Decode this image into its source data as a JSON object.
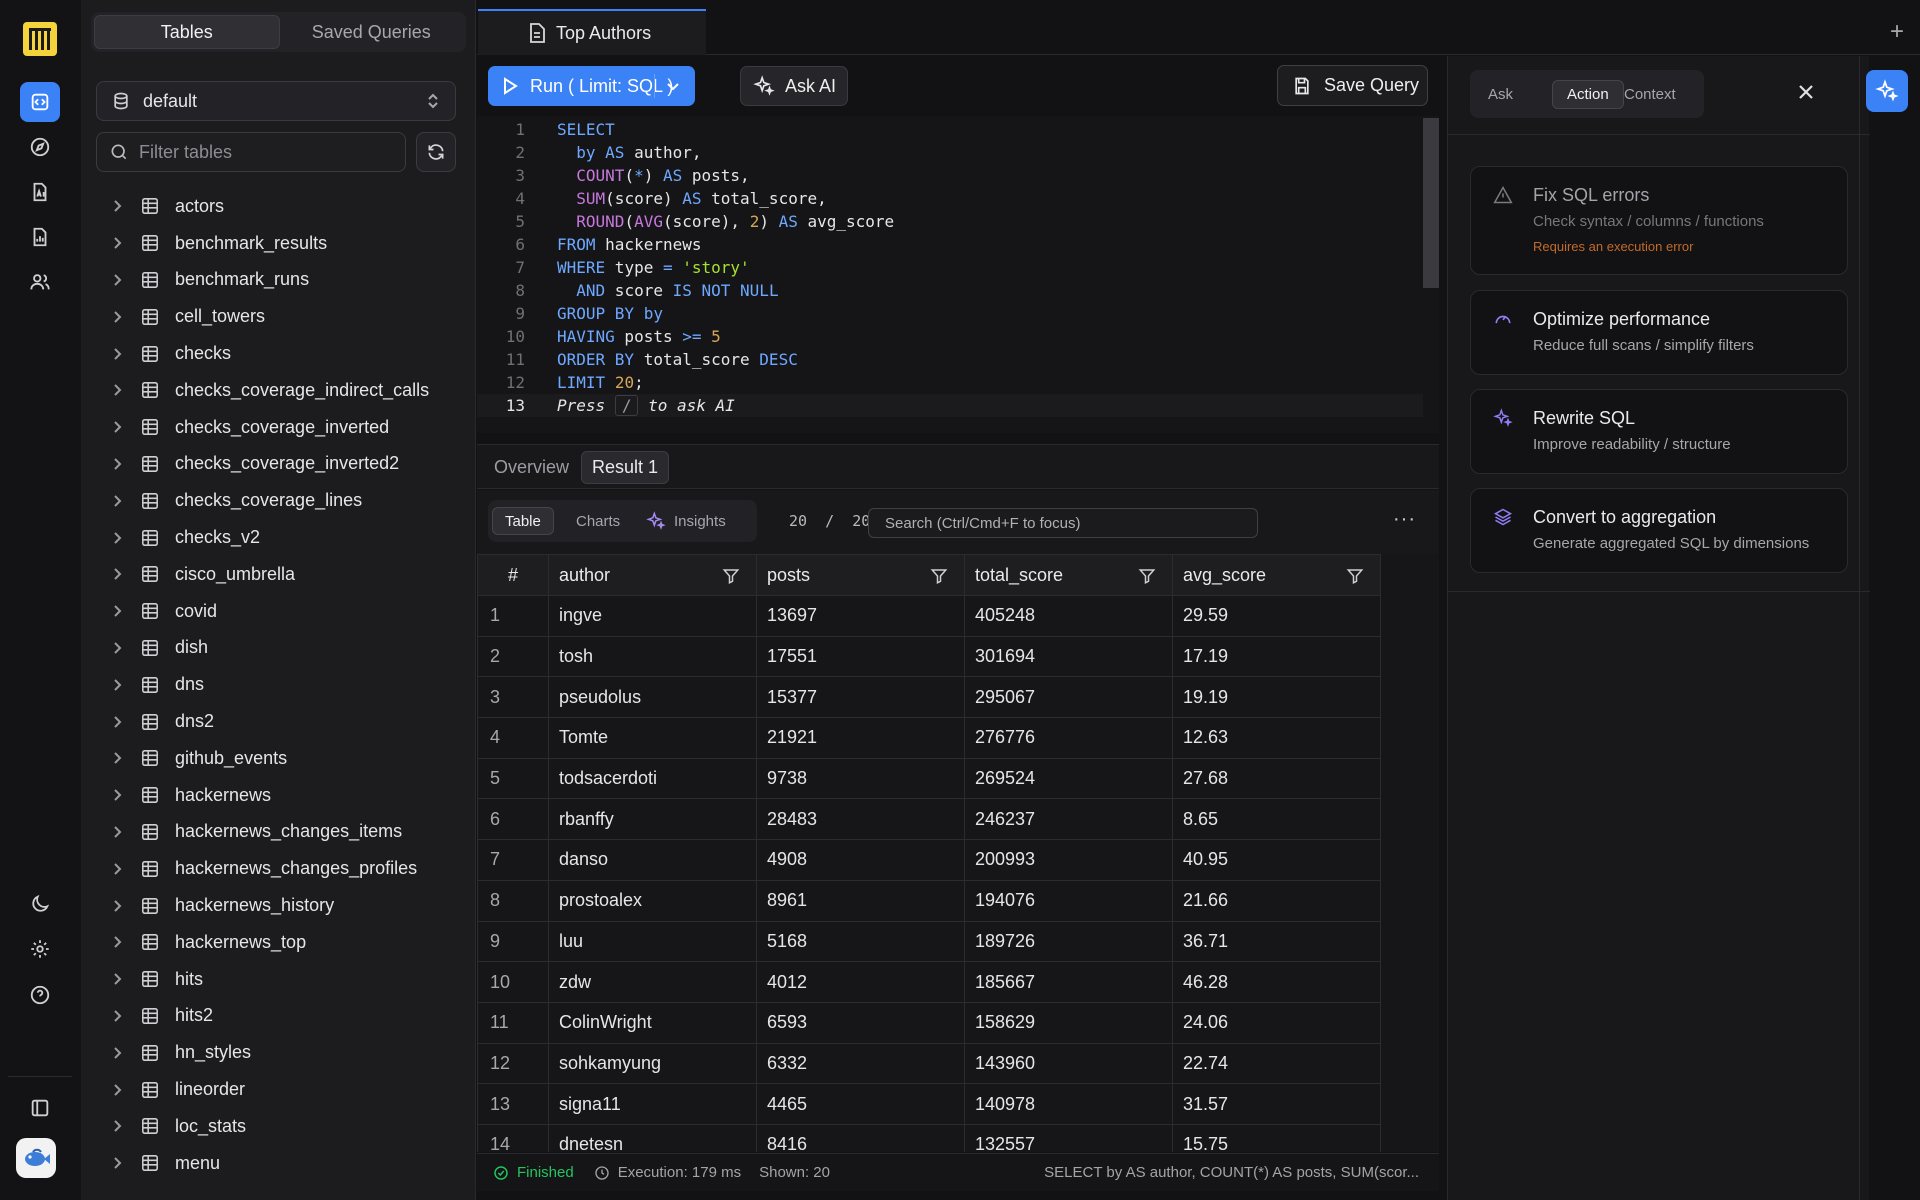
{
  "sidebar": {
    "tabs": [
      {
        "label": "Tables",
        "active": true
      },
      {
        "label": "Saved Queries",
        "active": false
      }
    ],
    "database": "default",
    "filter_placeholder": "Filter tables",
    "tables": [
      "actors",
      "benchmark_results",
      "benchmark_runs",
      "cell_towers",
      "checks",
      "checks_coverage_indirect_calls",
      "checks_coverage_inverted",
      "checks_coverage_inverted2",
      "checks_coverage_lines",
      "checks_v2",
      "cisco_umbrella",
      "covid",
      "dish",
      "dns",
      "dns2",
      "github_events",
      "hackernews",
      "hackernews_changes_items",
      "hackernews_changes_profiles",
      "hackernews_history",
      "hackernews_top",
      "hits",
      "hits2",
      "hn_styles",
      "lineorder",
      "loc_stats",
      "menu"
    ]
  },
  "editor_tab": {
    "title": "Top Authors"
  },
  "toolbar": {
    "run_label": "Run ( Limit: SQL )",
    "ask_ai_label": "Ask AI",
    "save_label": "Save Query"
  },
  "editor": {
    "hint_prefix": "Press",
    "hint_key": "/",
    "hint_suffix": "to ask AI",
    "line_numbers": [
      "1",
      "2",
      "3",
      "4",
      "5",
      "6",
      "7",
      "8",
      "9",
      "10",
      "11",
      "12",
      "13"
    ]
  },
  "results": {
    "tabs": [
      {
        "label": "Overview",
        "active": false
      },
      {
        "label": "Result 1",
        "active": true
      }
    ],
    "views": [
      {
        "label": "Table",
        "active": true
      },
      {
        "label": "Charts",
        "active": false
      },
      {
        "label": "Insights",
        "active": false
      }
    ],
    "page_count": "20  /  20",
    "search_placeholder": "Search (Ctrl/Cmd+F to focus)",
    "more_label": "···",
    "columns": [
      "#",
      "author",
      "posts",
      "total_score",
      "avg_score"
    ],
    "rows": [
      [
        "1",
        "ingve",
        "13697",
        "405248",
        "29.59"
      ],
      [
        "2",
        "tosh",
        "17551",
        "301694",
        "17.19"
      ],
      [
        "3",
        "pseudolus",
        "15377",
        "295067",
        "19.19"
      ],
      [
        "4",
        "Tomte",
        "21921",
        "276776",
        "12.63"
      ],
      [
        "5",
        "todsacerdoti",
        "9738",
        "269524",
        "27.68"
      ],
      [
        "6",
        "rbanffy",
        "28483",
        "246237",
        "8.65"
      ],
      [
        "7",
        "danso",
        "4908",
        "200993",
        "40.95"
      ],
      [
        "8",
        "prostoalex",
        "8961",
        "194076",
        "21.66"
      ],
      [
        "9",
        "luu",
        "5168",
        "189726",
        "36.71"
      ],
      [
        "10",
        "zdw",
        "4012",
        "185667",
        "46.28"
      ],
      [
        "11",
        "ColinWright",
        "6593",
        "158629",
        "24.06"
      ],
      [
        "12",
        "sohkamyung",
        "6332",
        "143960",
        "22.74"
      ],
      [
        "13",
        "signa11",
        "4465",
        "140978",
        "31.57"
      ],
      [
        "14",
        "dnetesn",
        "8416",
        "132557",
        "15.75"
      ]
    ]
  },
  "status": {
    "state": "Finished",
    "execution": "Execution: 179 ms",
    "shown": "Shown: 20",
    "query_preview": "SELECT by AS author, COUNT(*) AS posts, SUM(scor..."
  },
  "ai_panel": {
    "tabs": [
      {
        "label": "Ask",
        "active": false
      },
      {
        "label": "Action",
        "active": true
      },
      {
        "label": "Context",
        "active": false
      }
    ],
    "actions": [
      {
        "title": "Fix SQL errors",
        "desc": "Check syntax / columns / functions",
        "warning": "Requires an execution error",
        "icon": "alert-triangle-icon"
      },
      {
        "title": "Optimize performance",
        "desc": "Reduce full scans / simplify filters",
        "icon": "gauge-icon"
      },
      {
        "title": "Rewrite SQL",
        "desc": "Improve readability / structure",
        "icon": "sparkles-icon"
      },
      {
        "title": "Convert to aggregation",
        "desc": "Generate aggregated SQL by dimensions",
        "icon": "layers-icon"
      }
    ]
  },
  "colors": {
    "accent": "#3b82f6",
    "success": "#22c55e",
    "warning": "#c26a2a",
    "ai_icon": "#8f7ef5",
    "logo": "#f5d33a"
  }
}
